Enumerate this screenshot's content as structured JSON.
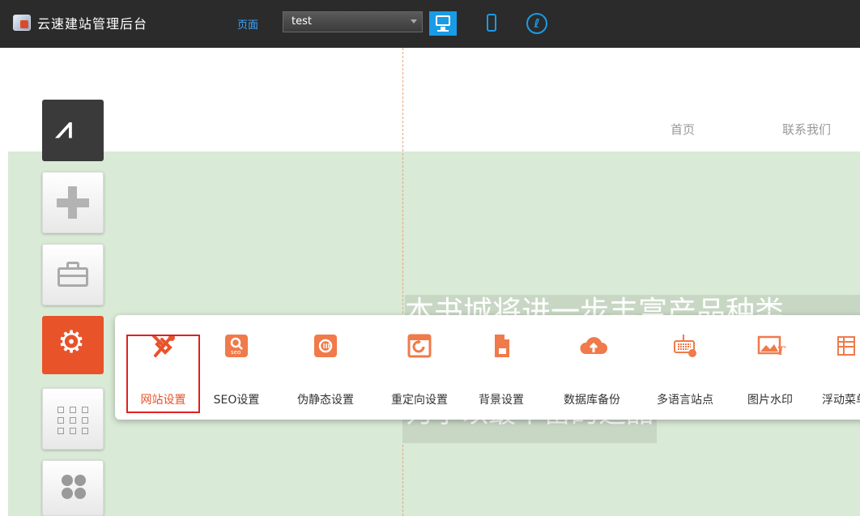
{
  "topbar": {
    "app_title": "云速建站管理后台",
    "page_label": "页面",
    "page_select_value": "test",
    "devices": [
      "desktop-icon",
      "mobile-icon",
      "mini-program-icon"
    ],
    "accent_color": "#1a9be6"
  },
  "canvas": {
    "nav": [
      "首页",
      "联系我们"
    ],
    "hero_line1": "本书城将进一步丰富产品种类",
    "hero_line2": "力争以最丰富的选品"
  },
  "toolbar": {
    "tools": [
      "apps-icon",
      "add-icon",
      "toolkit-icon",
      "settings-icon",
      "grid-icon",
      "clover-icon"
    ],
    "active_color": "#e8532a"
  },
  "settings_panel": {
    "items": [
      {
        "label": "网站设置",
        "icon": "wrench-screwdriver-icon",
        "active": true
      },
      {
        "label": "SEO设置",
        "icon": "seo-icon"
      },
      {
        "label": "伪静态设置",
        "icon": "pseudo-static-icon"
      },
      {
        "label": "重定向设置",
        "icon": "redirect-icon"
      },
      {
        "label": "背景设置",
        "icon": "background-icon"
      },
      {
        "label": "数据库备份",
        "icon": "cloud-upload-icon"
      },
      {
        "label": "多语言站点",
        "icon": "keyboard-icon"
      },
      {
        "label": "图片水印",
        "icon": "image-watermark-icon"
      },
      {
        "label": "浮动菜单",
        "icon": "floating-menu-icon"
      }
    ]
  }
}
